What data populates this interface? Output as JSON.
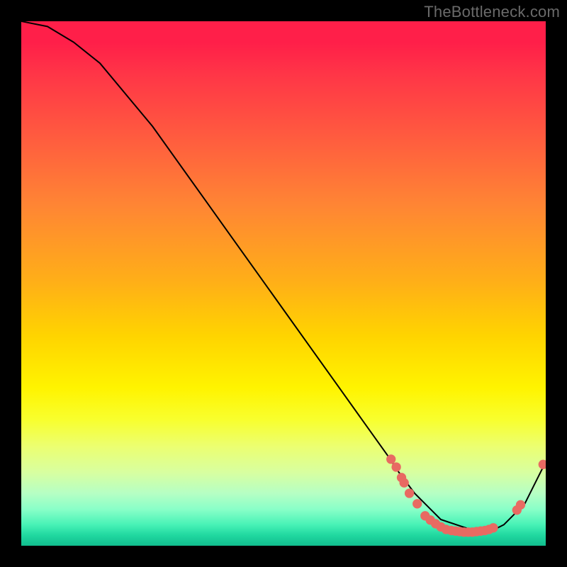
{
  "watermark": "TheBottleneck.com",
  "chart_data": {
    "type": "line",
    "title": "",
    "xlabel": "",
    "ylabel": "",
    "xlim": [
      0,
      100
    ],
    "ylim": [
      0,
      100
    ],
    "series": [
      {
        "name": "curve",
        "x": [
          0,
          5,
          10,
          15,
          20,
          25,
          30,
          35,
          40,
          45,
          50,
          55,
          60,
          65,
          70,
          72,
          75,
          78,
          80,
          83,
          86,
          88,
          90,
          92,
          94,
          96,
          98,
          100
        ],
        "y": [
          100,
          99,
          96,
          92,
          86,
          80,
          73,
          66,
          59,
          52,
          45,
          38,
          31,
          24,
          17,
          14,
          10,
          7,
          5,
          4,
          3,
          3,
          3,
          4,
          6,
          8,
          12,
          16
        ]
      }
    ],
    "points": [
      {
        "x": 70.5,
        "y": 16.5
      },
      {
        "x": 71.5,
        "y": 15.0
      },
      {
        "x": 72.5,
        "y": 13.0
      },
      {
        "x": 73.0,
        "y": 12.0
      },
      {
        "x": 74.0,
        "y": 10.0
      },
      {
        "x": 75.5,
        "y": 8.0
      },
      {
        "x": 77.0,
        "y": 5.7
      },
      {
        "x": 78.0,
        "y": 4.9
      },
      {
        "x": 79.0,
        "y": 4.2
      },
      {
        "x": 80.0,
        "y": 3.6
      },
      {
        "x": 81.0,
        "y": 3.1
      },
      {
        "x": 82.0,
        "y": 2.9
      },
      {
        "x": 82.8,
        "y": 2.8
      },
      {
        "x": 83.6,
        "y": 2.7
      },
      {
        "x": 84.4,
        "y": 2.6
      },
      {
        "x": 85.2,
        "y": 2.6
      },
      {
        "x": 86.0,
        "y": 2.6
      },
      {
        "x": 86.8,
        "y": 2.7
      },
      {
        "x": 87.6,
        "y": 2.8
      },
      {
        "x": 88.4,
        "y": 2.9
      },
      {
        "x": 89.2,
        "y": 3.1
      },
      {
        "x": 90.0,
        "y": 3.4
      },
      {
        "x": 94.5,
        "y": 6.8
      },
      {
        "x": 95.2,
        "y": 7.8
      },
      {
        "x": 99.5,
        "y": 15.5
      }
    ],
    "colors": {
      "curve": "#000000",
      "points": "#e86a62"
    }
  }
}
